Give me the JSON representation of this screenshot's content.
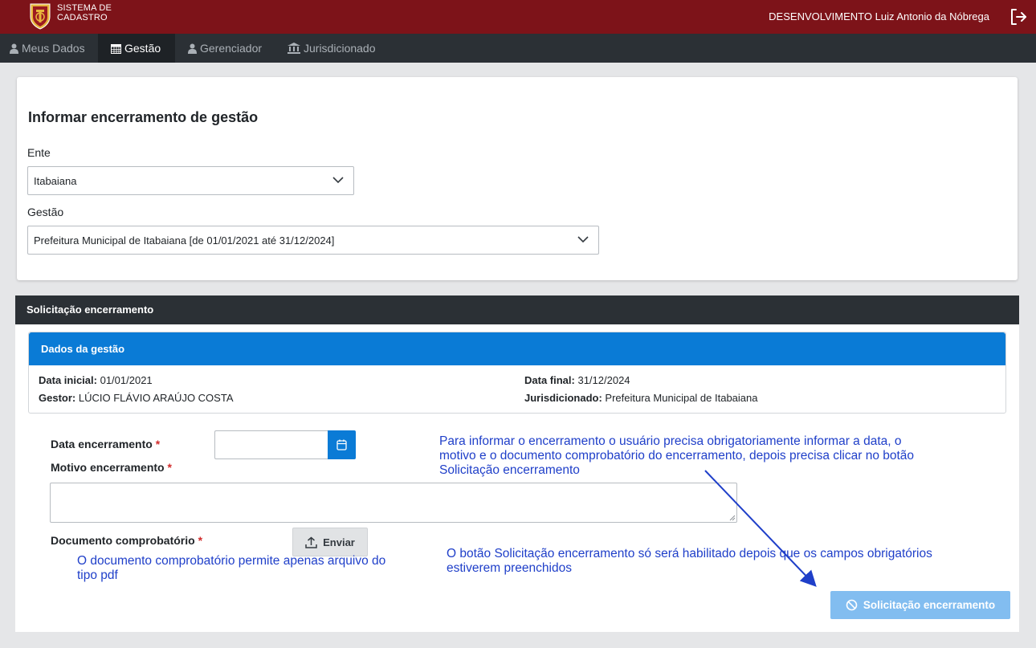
{
  "header": {
    "brand_line1": "SISTEMA DE",
    "brand_line2": "CADASTRO",
    "user": "DESENVOLVIMENTO Luiz Antonio da Nóbrega",
    "logout_icon": "logout-icon"
  },
  "nav": [
    {
      "label": "Meus Dados",
      "icon": "user-icon",
      "active": false
    },
    {
      "label": "Gestão",
      "icon": "calendar-icon",
      "active": true
    },
    {
      "label": "Gerenciador",
      "icon": "user-icon",
      "active": false
    },
    {
      "label": "Jurisdicionado",
      "icon": "bank-icon",
      "active": false
    }
  ],
  "form": {
    "title": "Informar encerramento de gestão",
    "ente_label": "Ente",
    "ente_value": "Itabaiana",
    "gestao_label": "Gestão",
    "gestao_value": "Prefeitura Municipal de Itabaiana [de 01/01/2021 até 31/12/2024]"
  },
  "section": {
    "title": "Solicitação encerramento",
    "dados": {
      "title": "Dados da gestão",
      "data_inicial_label": "Data inicial:",
      "data_inicial": "01/01/2021",
      "gestor_label": "Gestor:",
      "gestor": "LÚCIO FLÁVIO ARAÚJO COSTA",
      "data_final_label": "Data final:",
      "data_final": "31/12/2024",
      "jurisdicionado_label": "Jurisdicionado:",
      "jurisdicionado": "Prefeitura Municipal de Itabaiana"
    },
    "data_encerramento_label": "Data encerramento",
    "motivo_label": "Motivo encerramento",
    "documento_label": "Documento comprobatório",
    "required_mark": "*",
    "enviar_label": "Enviar",
    "submit_label": "Solicitação encerramento"
  },
  "annotations": {
    "note1": "Para informar o encerramento o usuário precisa obrigatoriamente informar a data, o motivo e o documento comprobatório do encerramento, depois precisa clicar no botão Solicitação encerramento",
    "note2": "O documento comprobatório permite apenas arquivo do tipo pdf",
    "note3": "O botão Solicitação encerramento só será habilitado depois que os campos obrigatórios estiverem preenchidos",
    "color": "#1f3fc9"
  },
  "colors": {
    "header": "#7d1319",
    "nav": "#2b3035",
    "primary": "#0a7bd6",
    "submit_disabled": "#82bdf0"
  }
}
